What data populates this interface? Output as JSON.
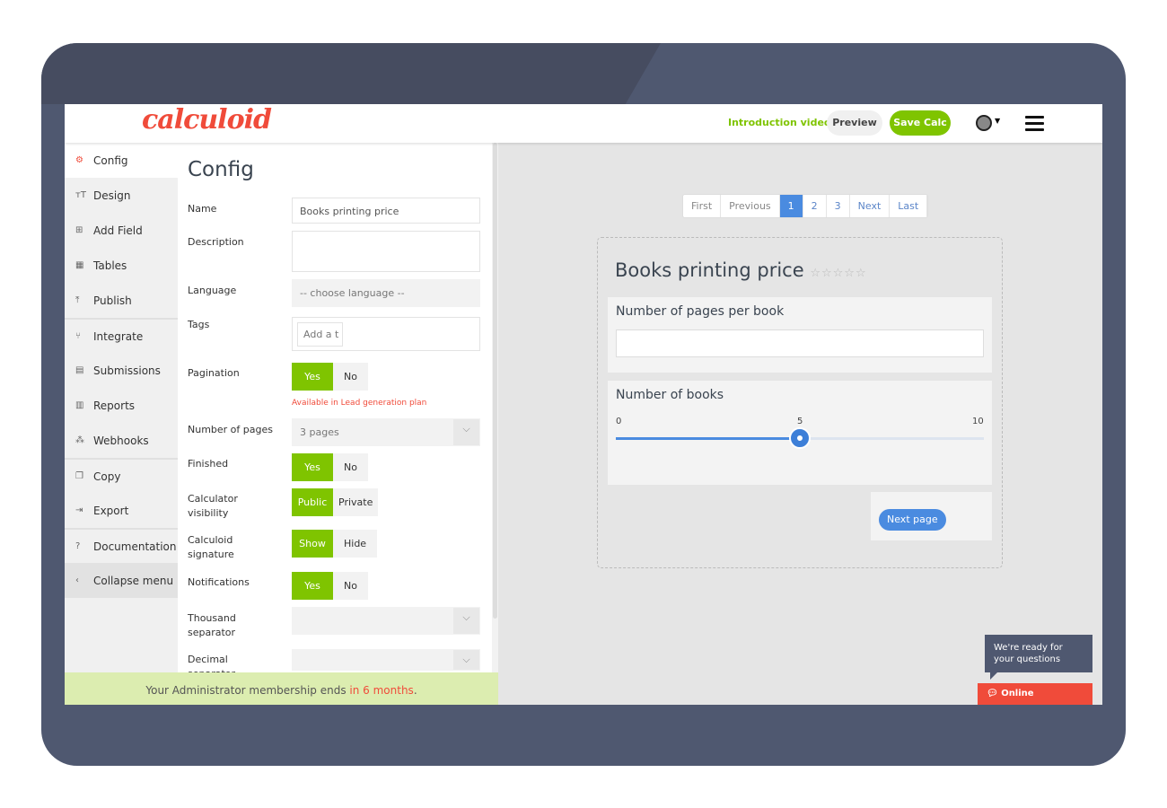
{
  "header": {
    "logo": "calculoid",
    "intro_video": "Introduction video",
    "preview": "Preview",
    "save": "Save Calc"
  },
  "sidebar": {
    "items": [
      {
        "label": "Config",
        "icon": "⚙",
        "name": "gear"
      },
      {
        "label": "Design",
        "icon": "ᴛT",
        "name": "text-size"
      },
      {
        "label": "Add Field",
        "icon": "⊞",
        "name": "plus-square"
      },
      {
        "label": "Tables",
        "icon": "▦",
        "name": "table"
      },
      {
        "label": "Publish",
        "icon": "⤒",
        "name": "upload"
      },
      {
        "label": "Integrate",
        "icon": "⑂",
        "name": "branch"
      },
      {
        "label": "Submissions",
        "icon": "▤",
        "name": "archive"
      },
      {
        "label": "Reports",
        "icon": "▥",
        "name": "bar-chart"
      },
      {
        "label": "Webhooks",
        "icon": "⁂",
        "name": "webhook"
      },
      {
        "label": "Copy",
        "icon": "❐",
        "name": "copy"
      },
      {
        "label": "Export",
        "icon": "⇥",
        "name": "export"
      },
      {
        "label": "Documentation",
        "icon": "?",
        "name": "question"
      },
      {
        "label": "Collapse menu",
        "icon": "‹",
        "name": "chevron-left"
      }
    ]
  },
  "config": {
    "title": "Config",
    "name_label": "Name",
    "name_value": "Books printing price",
    "description_label": "Description",
    "language_label": "Language",
    "language_placeholder": "-- choose language --",
    "tags_label": "Tags",
    "tags_placeholder": "Add a t",
    "pagination_label": "Pagination",
    "yes": "Yes",
    "no": "No",
    "pagination_note": "Available in Lead generation plan",
    "pages_label": "Number of pages",
    "pages_value": "3 pages",
    "finished_label": "Finished",
    "visibility_label": "Calculator visibility",
    "public": "Public",
    "private": "Private",
    "signature_label": "Calculoid signature",
    "show": "Show",
    "hide": "Hide",
    "notifications_label": "Notifications",
    "thousand_label": "Thousand separator",
    "decimal_label": "Decimal separator"
  },
  "footer": {
    "text": "Your Administrator membership ends ",
    "highlight": "in 6 months",
    "end": "."
  },
  "pager": [
    "First",
    "Previous",
    "1",
    "2",
    "3",
    "Next",
    "Last"
  ],
  "calc": {
    "title": "Books printing price",
    "stars": "☆☆☆☆☆",
    "field1": "Number of pages per book",
    "field2": "Number of books",
    "slider": {
      "min": "0",
      "mid": "5",
      "max": "10",
      "value": 5
    },
    "next": "Next page"
  },
  "chat": {
    "tip": "We're ready for your questions",
    "online": "Online"
  }
}
